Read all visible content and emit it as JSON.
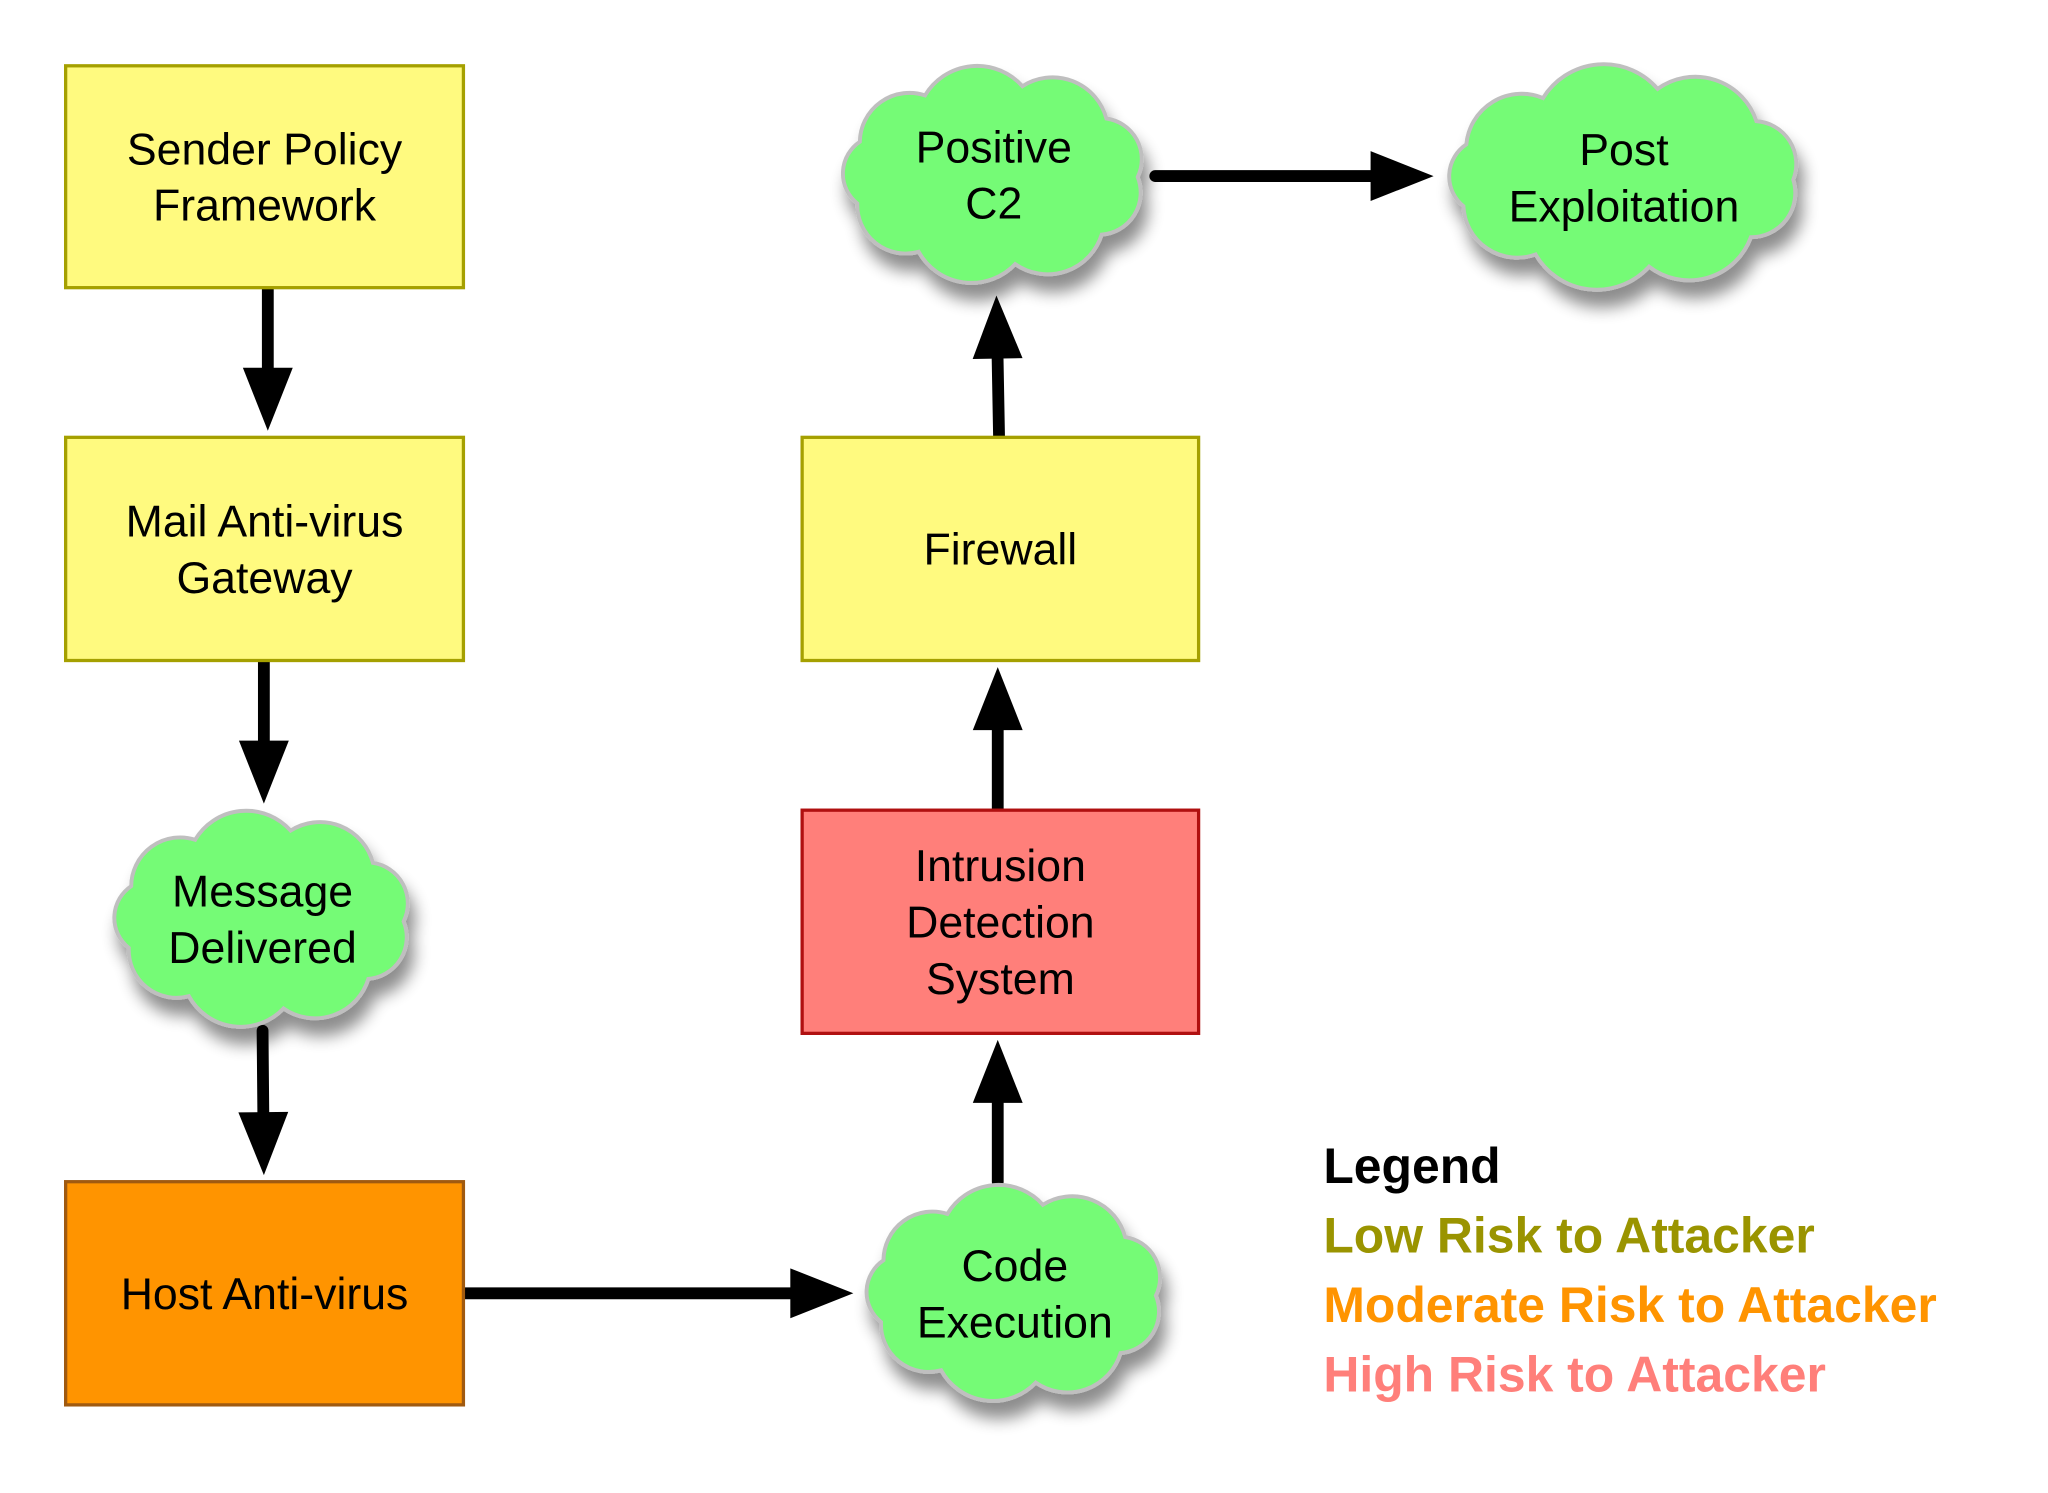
{
  "colors": {
    "low_fill": "#fffa7f",
    "low_stroke": "#a5a000",
    "moderate_fill": "#ff9400",
    "moderate_stroke": "#a05a10",
    "high_fill": "#ff7f7a",
    "high_stroke": "#b01010",
    "outcome_fill": "#74fb76",
    "outcome_stroke": "#bfbfbf",
    "arrow": "#000000"
  },
  "nodes": {
    "spf": {
      "lines": [
        "Sender Policy",
        "Framework"
      ],
      "risk": "low"
    },
    "mail_av": {
      "lines": [
        "Mail Anti-virus",
        "Gateway"
      ],
      "risk": "low"
    },
    "message_delivered": {
      "lines": [
        "Message",
        "Delivered"
      ],
      "kind": "outcome"
    },
    "host_av": {
      "lines": [
        "Host Anti-virus"
      ],
      "risk": "moderate"
    },
    "code_execution": {
      "lines": [
        "Code",
        "Execution"
      ],
      "kind": "outcome"
    },
    "ids": {
      "lines": [
        "Intrusion",
        "Detection",
        "System"
      ],
      "risk": "high"
    },
    "firewall": {
      "lines": [
        "Firewall"
      ],
      "risk": "low"
    },
    "positive_c2": {
      "lines": [
        "Positive",
        "C2"
      ],
      "kind": "outcome"
    },
    "post_exploitation": {
      "lines": [
        "Post",
        "Exploitation"
      ],
      "kind": "outcome"
    }
  },
  "edges": [
    [
      "spf",
      "mail_av"
    ],
    [
      "mail_av",
      "message_delivered"
    ],
    [
      "message_delivered",
      "host_av"
    ],
    [
      "host_av",
      "code_execution"
    ],
    [
      "code_execution",
      "ids"
    ],
    [
      "ids",
      "firewall"
    ],
    [
      "firewall",
      "positive_c2"
    ],
    [
      "positive_c2",
      "post_exploitation"
    ]
  ],
  "legend": {
    "title": "Legend",
    "low": "Low Risk to Attacker",
    "moderate": "Moderate Risk to Attacker",
    "high": "High Risk to Attacker",
    "low_color": "#9a9400",
    "moderate_color": "#ff9400",
    "high_color": "#ff7f7a"
  }
}
